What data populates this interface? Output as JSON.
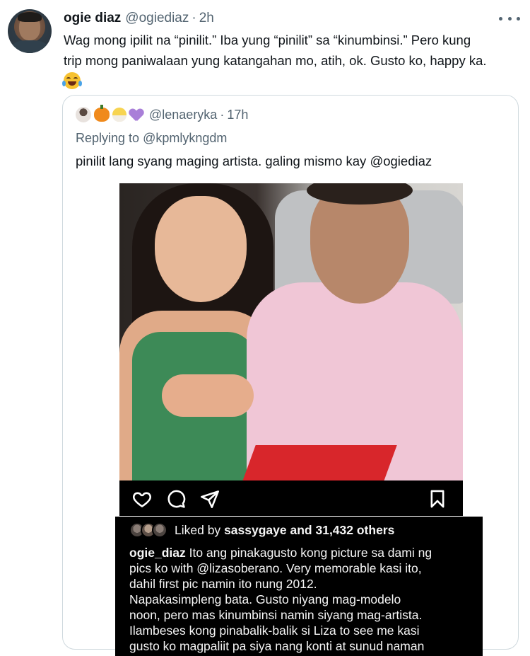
{
  "tweet": {
    "display_name": "ogie diaz",
    "handle": "@ogiediaz",
    "separator": "·",
    "time": "2h",
    "text_lines": [
      "Wag mong ipilit na “pinilit.” Iba yung “pinilit” sa “kinumbinsi.” Pero kung",
      "trip mong paniwalaan yung katangahan mo, atih, ok. Gusto ko, happy ka."
    ],
    "emoji": "face-with-tears-of-joy"
  },
  "quoted_tweet": {
    "handle": "@lenaeryka",
    "separator": "·",
    "time": "17h",
    "name_emojis": [
      "jack-o-lantern",
      "hatching-chick",
      "purple-heart"
    ],
    "reply_prefix": "Replying to",
    "reply_to": "@kpmlykngdm",
    "text": "pinilit lang syang maging artista. galing mismo kay @ogiediaz"
  },
  "instagram": {
    "icons": [
      "heart-icon",
      "comment-icon",
      "share-icon",
      "bookmark-icon"
    ],
    "liked_prefix": "Liked by",
    "liked_user": "sassygaye",
    "liked_suffix": "and 31,432 others",
    "caption_user": "ogie_diaz",
    "caption_first": "Ito ang pinakagusto kong picture sa dami ng",
    "caption_lines": [
      "pics ko with @lizasoberano. Very memorable kasi ito,",
      "dahil first pic namin ito nung 2012.",
      "Napakasimpleng bata.  Gusto niyang mag-modelo",
      "noon, pero mas kinumbinsi namin siyang mag-artista.",
      "Ilambeses kong pinabalik-balik si Liza to see me kasi",
      "gusto ko magpaliit pa siya nang konti at sunud naman"
    ]
  }
}
